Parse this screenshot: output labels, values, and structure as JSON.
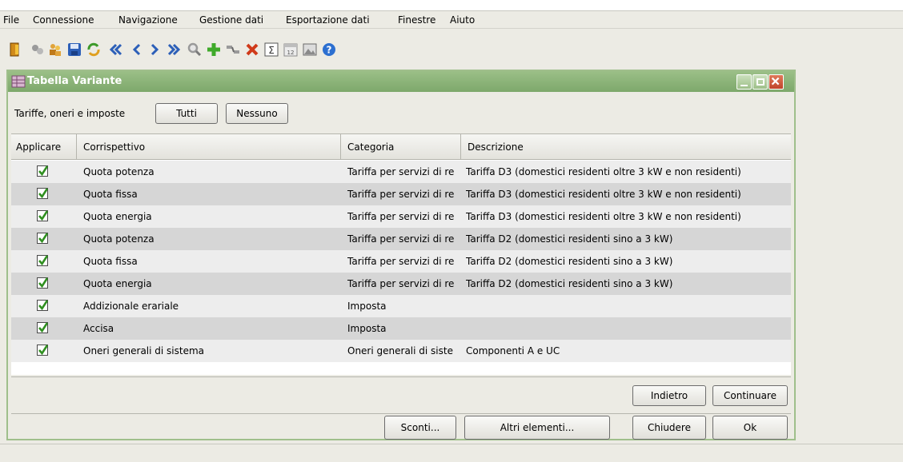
{
  "menu": [
    "File",
    "Connessione",
    "Navigazione",
    "Gestione dati",
    "Esportazione dati",
    "Finestre",
    "Aiuto"
  ],
  "toolbar_icons": [
    "exit-icon",
    "connect-icon",
    "users-icon",
    "save-icon",
    "refresh-icon",
    "first-icon",
    "previous-icon",
    "next-icon",
    "last-icon",
    "search-icon",
    "add-icon",
    "link-icon",
    "delete-icon",
    "sum-icon",
    "calendar-icon",
    "image-icon",
    "help-icon"
  ],
  "window": {
    "title": "Tabella Variante",
    "filter_label": "Tariffe, oneri e imposte",
    "all_button": "Tutti",
    "none_button": "Nessuno"
  },
  "table": {
    "headers": [
      "Applicare",
      "Corrispettivo",
      "Categoria",
      "Descrizione"
    ],
    "rows": [
      {
        "checked": true,
        "corrispettivo": "Quota potenza",
        "categoria": "Tariffa per servizi di re",
        "descrizione": "Tariffa D3 (domestici residenti oltre 3 kW e non residenti)"
      },
      {
        "checked": true,
        "corrispettivo": "Quota fissa",
        "categoria": "Tariffa per servizi di re",
        "descrizione": "Tariffa D3 (domestici residenti oltre 3 kW e non residenti)"
      },
      {
        "checked": true,
        "corrispettivo": "Quota energia",
        "categoria": "Tariffa per servizi di re",
        "descrizione": "Tariffa D3 (domestici residenti oltre 3 kW e non residenti)"
      },
      {
        "checked": true,
        "corrispettivo": "Quota potenza",
        "categoria": "Tariffa per servizi di re",
        "descrizione": "Tariffa D2 (domestici residenti sino a 3 kW)"
      },
      {
        "checked": true,
        "corrispettivo": "Quota fissa",
        "categoria": "Tariffa per servizi di re",
        "descrizione": "Tariffa D2 (domestici residenti sino a 3 kW)"
      },
      {
        "checked": true,
        "corrispettivo": "Quota energia",
        "categoria": "Tariffa per servizi di re",
        "descrizione": "Tariffa D2 (domestici residenti sino a 3 kW)"
      },
      {
        "checked": true,
        "corrispettivo": "Addizionale erariale",
        "categoria": "Imposta",
        "descrizione": ""
      },
      {
        "checked": true,
        "corrispettivo": "Accisa",
        "categoria": "Imposta",
        "descrizione": ""
      },
      {
        "checked": true,
        "corrispettivo": "Oneri generali di sistema",
        "categoria": "Oneri generali di siste",
        "descrizione": "Componenti A e UC"
      }
    ]
  },
  "nav_buttons": {
    "back": "Indietro",
    "continue": "Continuare"
  },
  "footer_buttons": {
    "discounts": "Sconti...",
    "other": "Altri elementi...",
    "close": "Chiudere",
    "ok": "Ok"
  },
  "colors": {
    "title_bar": "#8fb67b",
    "checkmark": "#2f8f1f",
    "close_button": "#d0583a"
  }
}
